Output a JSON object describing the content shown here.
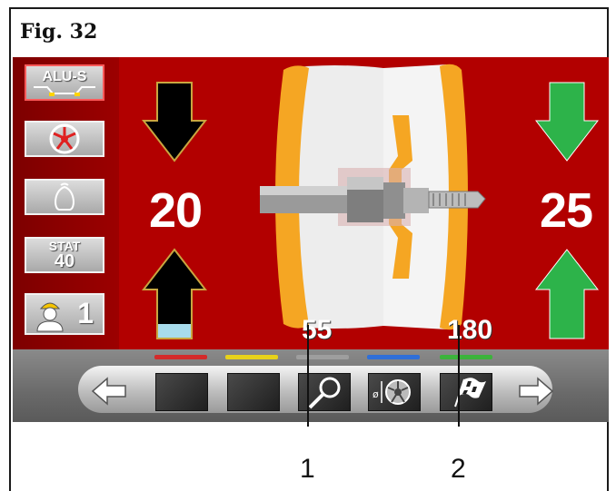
{
  "figure": {
    "title": "Fig.  32"
  },
  "sidebar": {
    "alu_label": "ALU-S",
    "stat_label": "STAT",
    "stat_value": "40",
    "operator_number": "1"
  },
  "display": {
    "left_value": "20",
    "right_value": "25",
    "callout_value_1": "55",
    "callout_value_2": "180"
  },
  "callouts": {
    "one": "1",
    "two": "2"
  },
  "colors": {
    "background_red": "#b20000",
    "arrow_green": "#2db34a",
    "tab_red": "#d42a2a",
    "tab_yellow": "#e8d21a",
    "tab_gray": "#9e9e9e",
    "tab_blue": "#2f6fd8",
    "tab_green": "#3cb33c"
  },
  "toolbar": {
    "icons": [
      "arrow-left-icon",
      "blank-icon",
      "blank-icon",
      "magnifier-icon",
      "wheel-diameter-icon",
      "flag-icon",
      "arrow-right-icon"
    ]
  }
}
